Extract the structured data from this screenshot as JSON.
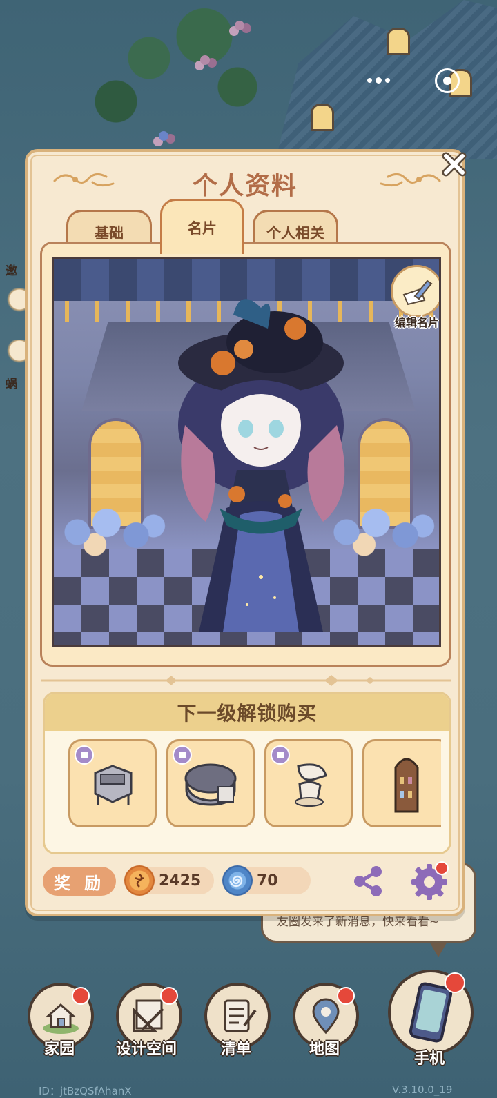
{
  "modal": {
    "title": "个人资料",
    "tabs": [
      {
        "label": "基础",
        "active": false
      },
      {
        "label": "名片",
        "active": true
      },
      {
        "label": "个人相关",
        "active": false
      }
    ],
    "edit_card_label": "编辑名片",
    "unlock": {
      "title": "下一级解锁购买",
      "items": [
        {
          "icon": "stove-icon"
        },
        {
          "icon": "armchair-icon"
        },
        {
          "icon": "stand-mixer-icon"
        },
        {
          "icon": "bottle-shelf-icon"
        }
      ]
    },
    "reward_label": "奖 励",
    "currency": {
      "gold": "2425",
      "gem": "70"
    }
  },
  "background": {
    "side_hints": [
      "邀",
      "蜗"
    ],
    "chat_text": "友圈发来了新消息，快来看看~"
  },
  "nav": {
    "items": [
      {
        "label": "家园",
        "icon": "home-icon",
        "badge": true
      },
      {
        "label": "设计空间",
        "icon": "design-ruler-icon",
        "badge": true
      },
      {
        "label": "清单",
        "icon": "checklist-icon",
        "badge": false
      },
      {
        "label": "地图",
        "icon": "map-pin-icon",
        "badge": true
      },
      {
        "label": "手机",
        "icon": "phone-icon",
        "badge": true
      }
    ]
  },
  "footer": {
    "id": "ID：jtBzQSfAhanX",
    "version": "V.3.10.0_19"
  },
  "colors": {
    "accent": "#b26d48",
    "panel": "#f7e9d1",
    "badge_red": "#e5483a"
  }
}
